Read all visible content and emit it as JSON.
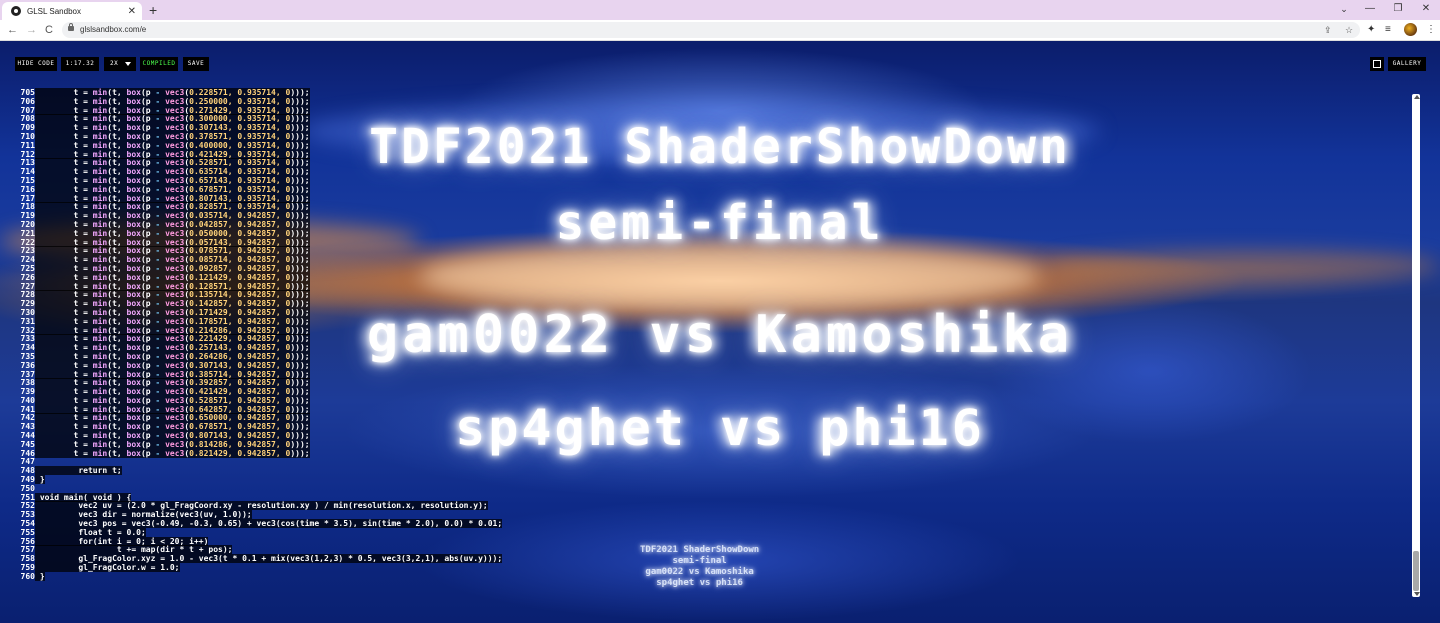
{
  "browser": {
    "tab_title": "GLSL Sandbox",
    "tab_close": "✕",
    "new_tab": "+",
    "url": "glslsandbox.com/e",
    "back": "←",
    "forward": "→",
    "reload": "C",
    "share_icon": "⇪",
    "star_icon": "☆",
    "ext_icon": "✦",
    "list_icon": "≡",
    "menu_icon": "⋮",
    "win_chevron": "⌄",
    "win_min": "—",
    "win_max": "❐",
    "win_close": "✕"
  },
  "toolbar": {
    "hide_code": "HIDE CODE",
    "time": "1:17.32",
    "resolution": "2X",
    "status": "COMPILED",
    "save": "SAVE",
    "gallery": "GALLERY"
  },
  "shader_text": {
    "line1": "TDF2021 ShaderShowDown",
    "line2": "semi-final",
    "line3": "gam0022 vs Kamoshika",
    "line4": "sp4ghet vs phi16"
  },
  "code": {
    "box_lines": [
      {
        "n": "705",
        "v": "0.228571, 0.935714"
      },
      {
        "n": "706",
        "v": "0.250000, 0.935714"
      },
      {
        "n": "707",
        "v": "0.271429, 0.935714"
      },
      {
        "n": "708",
        "v": "0.300000, 0.935714"
      },
      {
        "n": "709",
        "v": "0.307143, 0.935714"
      },
      {
        "n": "710",
        "v": "0.378571, 0.935714"
      },
      {
        "n": "711",
        "v": "0.400000, 0.935714"
      },
      {
        "n": "712",
        "v": "0.421429, 0.935714"
      },
      {
        "n": "713",
        "v": "0.528571, 0.935714"
      },
      {
        "n": "714",
        "v": "0.635714, 0.935714"
      },
      {
        "n": "715",
        "v": "0.657143, 0.935714"
      },
      {
        "n": "716",
        "v": "0.678571, 0.935714"
      },
      {
        "n": "717",
        "v": "0.807143, 0.935714"
      },
      {
        "n": "718",
        "v": "0.828571, 0.935714"
      },
      {
        "n": "719",
        "v": "0.035714, 0.942857"
      },
      {
        "n": "720",
        "v": "0.042857, 0.942857"
      },
      {
        "n": "721",
        "v": "0.050000, 0.942857"
      },
      {
        "n": "722",
        "v": "0.057143, 0.942857"
      },
      {
        "n": "723",
        "v": "0.078571, 0.942857"
      },
      {
        "n": "724",
        "v": "0.085714, 0.942857"
      },
      {
        "n": "725",
        "v": "0.092857, 0.942857"
      },
      {
        "n": "726",
        "v": "0.121429, 0.942857"
      },
      {
        "n": "727",
        "v": "0.128571, 0.942857"
      },
      {
        "n": "728",
        "v": "0.135714, 0.942857"
      },
      {
        "n": "729",
        "v": "0.142857, 0.942857"
      },
      {
        "n": "730",
        "v": "0.171429, 0.942857"
      },
      {
        "n": "731",
        "v": "0.178571, 0.942857"
      },
      {
        "n": "732",
        "v": "0.214286, 0.942857"
      },
      {
        "n": "733",
        "v": "0.221429, 0.942857"
      },
      {
        "n": "734",
        "v": "0.257143, 0.942857"
      },
      {
        "n": "735",
        "v": "0.264286, 0.942857"
      },
      {
        "n": "736",
        "v": "0.307143, 0.942857"
      },
      {
        "n": "737",
        "v": "0.385714, 0.942857"
      },
      {
        "n": "738",
        "v": "0.392857, 0.942857"
      },
      {
        "n": "739",
        "v": "0.421429, 0.942857"
      },
      {
        "n": "740",
        "v": "0.528571, 0.942857"
      },
      {
        "n": "741",
        "v": "0.642857, 0.942857"
      },
      {
        "n": "742",
        "v": "0.650000, 0.942857"
      },
      {
        "n": "743",
        "v": "0.678571, 0.942857"
      },
      {
        "n": "744",
        "v": "0.807143, 0.942857"
      },
      {
        "n": "745",
        "v": "0.814286, 0.942857"
      },
      {
        "n": "746",
        "v": "0.821429, 0.942857"
      }
    ],
    "tail_lines": [
      {
        "n": "747",
        "t": ""
      },
      {
        "n": "748",
        "t": "        return t;"
      },
      {
        "n": "749",
        "t": "}"
      },
      {
        "n": "750",
        "t": ""
      },
      {
        "n": "751",
        "t": "void main( void ) {"
      },
      {
        "n": "752",
        "t": "        vec2 uv = (2.0 * gl_FragCoord.xy - resolution.xy ) / min(resolution.x, resolution.y);"
      },
      {
        "n": "753",
        "t": "        vec3 dir = normalize(vec3(uv, 1.0));"
      },
      {
        "n": "754",
        "t": "        vec3 pos = vec3(-0.49, -0.3, 0.65) + vec3(cos(time * 3.5), sin(time * 2.0), 0.0) * 0.01;"
      },
      {
        "n": "755",
        "t": "        float t = 0.0;"
      },
      {
        "n": "756",
        "t": "        for(int i = 0; i < 20; i++)"
      },
      {
        "n": "757",
        "t": "                t += map(dir * t + pos);"
      },
      {
        "n": "758",
        "t": "        gl_FragColor.xyz = 1.0 - vec3(t * 0.1 + mix(vec3(1,2,3) * 0.5, vec3(3,2,1), abs(uv.y)));"
      },
      {
        "n": "759",
        "t": "        gl_FragColor.w = 1.0;"
      },
      {
        "n": "760",
        "t": "}"
      }
    ]
  }
}
